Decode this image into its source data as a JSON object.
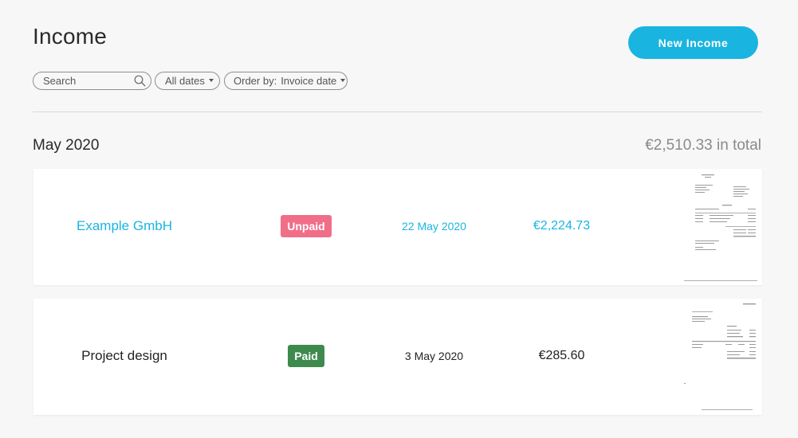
{
  "header": {
    "title": "Income",
    "new_button_label": "New Income"
  },
  "filters": {
    "search_placeholder": "Search",
    "dates_label": "All dates",
    "order_prefix": "Order by:",
    "order_value": "Invoice date"
  },
  "group": {
    "title": "May 2020",
    "total": "€2,510.33 in total"
  },
  "invoices": [
    {
      "name": "Example GmbH",
      "status": "Unpaid",
      "date": "22 May 2020",
      "amount": "€2,224.73"
    },
    {
      "name": "Project design",
      "status": "Paid",
      "date": "3 May 2020",
      "amount": "€285.60"
    }
  ],
  "colors": {
    "accent": "#1ab4e0",
    "unpaid_badge": "#f06e88",
    "paid_badge": "#3e8a4e"
  },
  "icons": {
    "search": "search-icon",
    "dropdown": "chevron-down-icon"
  }
}
